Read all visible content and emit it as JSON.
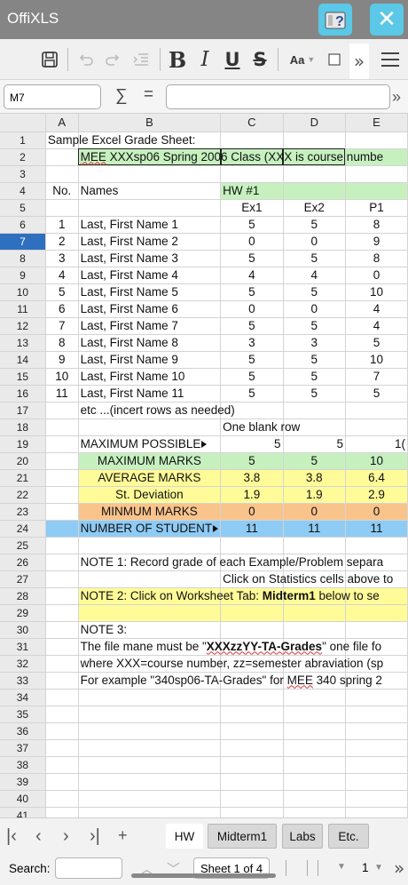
{
  "app": {
    "title": "OffiXLS"
  },
  "titlebar": {
    "help_label": "?",
    "close_label": "✕"
  },
  "toolbar": {
    "bold_label": "B",
    "italic_label": "I",
    "underline_label": "U",
    "strike_label": "S",
    "font_size_label": "Aa",
    "more_label": "»",
    "icons": [
      "save-icon",
      "undo-icon",
      "redo-icon",
      "indent-icon",
      "border-icon",
      "menu-icon"
    ]
  },
  "formula_bar": {
    "cell_ref": "M7",
    "sum_label": "∑",
    "equals_label": "=",
    "formula": "",
    "more_label": "»"
  },
  "grid": {
    "columns": [
      "A",
      "B",
      "C",
      "D",
      "E"
    ],
    "selected_row": 7,
    "row_numbers": [
      1,
      2,
      3,
      4,
      5,
      6,
      7,
      8,
      9,
      10,
      11,
      12,
      13,
      14,
      15,
      16,
      17,
      18,
      19,
      20,
      21,
      22,
      23,
      24,
      25,
      26,
      27,
      28,
      29,
      30,
      31,
      32,
      33,
      34,
      35,
      36,
      37,
      38,
      39,
      40,
      41
    ],
    "r1": "Sample Excel Grade Sheet:",
    "r2": {
      "pre": "MEE",
      "rest": " XXXsp06 Spring 2006 Class (XXX is course numbe"
    },
    "r4": {
      "a": "No.",
      "b": "Names",
      "c": "HW #1"
    },
    "r5": {
      "c": "Ex1",
      "d": "Ex2",
      "e": "P1"
    },
    "students": [
      {
        "no": "1",
        "name": "Last, First Name 1",
        "ex1": "5",
        "ex2": "5",
        "p1": "8"
      },
      {
        "no": "2",
        "name": "Last, First Name 2",
        "ex1": "0",
        "ex2": "0",
        "p1": "9"
      },
      {
        "no": "3",
        "name": "Last, First Name 3",
        "ex1": "5",
        "ex2": "5",
        "p1": "8"
      },
      {
        "no": "4",
        "name": "Last, First Name 4",
        "ex1": "4",
        "ex2": "4",
        "p1": "0"
      },
      {
        "no": "5",
        "name": "Last, First Name 5",
        "ex1": "5",
        "ex2": "5",
        "p1": "10"
      },
      {
        "no": "6",
        "name": "Last, First Name 6",
        "ex1": "0",
        "ex2": "0",
        "p1": "4"
      },
      {
        "no": "7",
        "name": "Last, First Name 7",
        "ex1": "5",
        "ex2": "5",
        "p1": "4"
      },
      {
        "no": "8",
        "name": "Last, First Name 8",
        "ex1": "3",
        "ex2": "3",
        "p1": "5"
      },
      {
        "no": "9",
        "name": "Last, First Name 9",
        "ex1": "5",
        "ex2": "5",
        "p1": "10"
      },
      {
        "no": "10",
        "name": "Last, First Name 10",
        "ex1": "5",
        "ex2": "5",
        "p1": "7"
      },
      {
        "no": "11",
        "name": "Last, First Name 11",
        "ex1": "5",
        "ex2": "5",
        "p1": "5"
      }
    ],
    "r17": "etc ...(incert rows as needed)",
    "r18": "One blank row",
    "r19": {
      "label": "MAXIMUM POSSIBLE",
      "c": "5",
      "d": "5",
      "e": "1("
    },
    "stats": [
      {
        "label": "MAXIMUM MARKS",
        "c": "5",
        "d": "5",
        "e": "10",
        "cls": "g"
      },
      {
        "label": "AVERAGE MARKS",
        "c": "3.8",
        "d": "3.8",
        "e": "6.4",
        "cls": "y"
      },
      {
        "label": "St. Deviation",
        "c": "1.9",
        "d": "1.9",
        "e": "2.9",
        "cls": "y"
      },
      {
        "label": "MINMUM MARKS",
        "c": "0",
        "d": "0",
        "e": "0",
        "cls": "o"
      },
      {
        "label": "NUMBER OF STUDENT",
        "c": "11",
        "d": "11",
        "e": "11",
        "cls": "b"
      }
    ],
    "r26": "NOTE 1: Record grade of each Example/Problem separa",
    "r27": "Click on Statistics cells above to",
    "r28": {
      "pre": "NOTE 2: Click on Worksheet Tab: ",
      "bold": "Midterm1",
      "post": " below to se"
    },
    "r30": "NOTE 3:",
    "r31": {
      "pre": "The file mane must be \"",
      "bold": "XXXzzYY-TA-Grades",
      "post": "\" one file fo"
    },
    "r32": "where XXX=course number, zz=semester abraviation (sp",
    "r33": {
      "pre": "For example \"340sp06-TA-Grades\" for ",
      "wavy": "MEE",
      "post": " 340 spring 2"
    }
  },
  "tabs": {
    "sheets": [
      "HW",
      "Midterm1",
      "Labs",
      "Etc."
    ],
    "active": "HW",
    "first_label": "|<",
    "prev_label": "<",
    "next_label": ">",
    "last_label": ">|",
    "add_label": "+"
  },
  "status": {
    "search_label": "Search:",
    "search_value": "",
    "sheet_indicator": "Sheet 1 of 4",
    "zoom": "1",
    "more_label": "»"
  }
}
